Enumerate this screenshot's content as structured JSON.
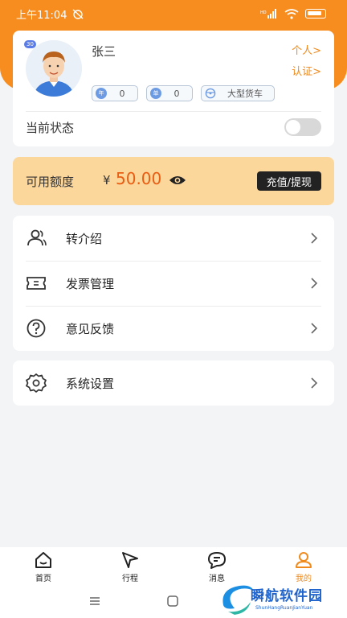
{
  "status_bar": {
    "time": "上午11:04"
  },
  "profile": {
    "name": "张三",
    "avatar_badge": "30",
    "personal_link": "个人>",
    "certify_link": "认证>",
    "tags": [
      {
        "icon_text": "年",
        "value": "0"
      },
      {
        "icon_text": "单",
        "value": "0"
      },
      {
        "icon": "steering-wheel-icon",
        "value": "大型货车"
      }
    ],
    "state_label": "当前状态",
    "state_on": false
  },
  "balance": {
    "label": "可用额度",
    "currency": "¥",
    "value": "50.00",
    "action": "充值/提现"
  },
  "menu": [
    {
      "icon": "referral-users-icon",
      "label": "转介绍"
    },
    {
      "icon": "invoice-ticket-icon",
      "label": "发票管理"
    },
    {
      "icon": "help-question-icon",
      "label": "意见反馈"
    }
  ],
  "settings": {
    "icon": "gear-icon",
    "label": "系统设置"
  },
  "tabs": [
    {
      "icon": "home-icon",
      "label": "首页",
      "active": false
    },
    {
      "icon": "navigation-arrow-icon",
      "label": "行程",
      "active": false
    },
    {
      "icon": "message-bubble-icon",
      "label": "消息",
      "active": false
    },
    {
      "icon": "user-profile-icon",
      "label": "我的",
      "active": true
    }
  ],
  "watermark": {
    "title": "瞬航软件园",
    "subtitle": "ShunHangRuanJianYuan"
  },
  "colors": {
    "primary_orange": "#f78d1e",
    "accent_text": "#f08a1c",
    "balance_bg": "#fcd79c",
    "balance_value": "#e85d12"
  }
}
